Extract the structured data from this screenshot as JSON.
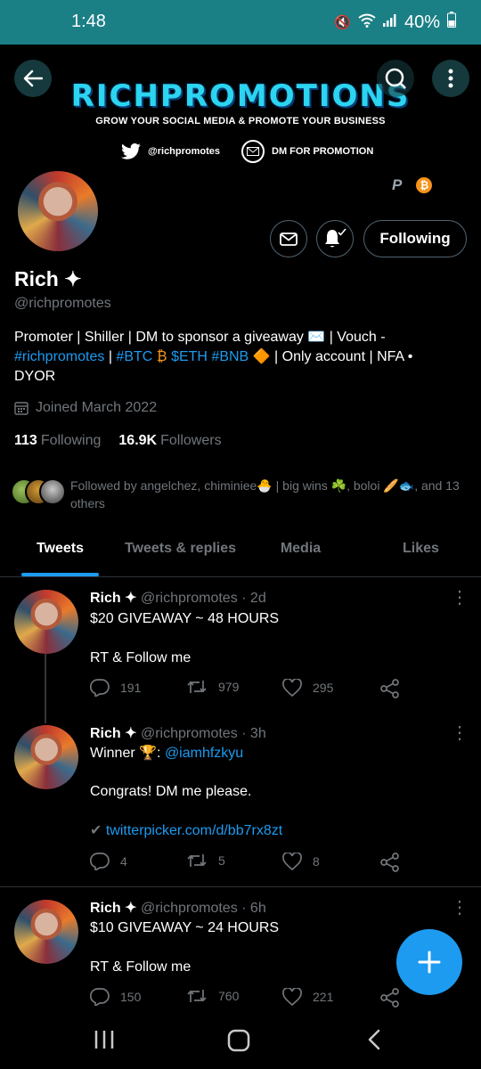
{
  "status_bar": {
    "time": "1:48",
    "battery": "40%"
  },
  "banner": {
    "title": "RICHPROMOTIONS",
    "tagline": "GROW YOUR SOCIAL MEDIA & PROMOTE YOUR BUSINESS",
    "twitter_handle": "@richpromotes",
    "dm_text": "DM FOR PROMOTION"
  },
  "profile": {
    "name": "Rich ✦",
    "handle": "@richpromotes",
    "bio_1": "Promoter | Shiller | DM to sponsor a giveaway ✉️ | Vouch -",
    "bio_tag1": "#richpromotes",
    "bio_sep1": " | ",
    "bio_tag2": "#BTC",
    "bio_emoji1": " ₿ ",
    "bio_tag3": "$ETH",
    "bio_sp": " ",
    "bio_tag4": "#BNB",
    "bio_rest": " 🔶 | Only account | NFA •",
    "bio_end": "DYOR",
    "joined": "Joined March 2022",
    "following_count": "113",
    "following_label": "Following",
    "followers_count": "16.9K",
    "followers_label": "Followers",
    "followed_by": "Followed by angelchez, chiminiee🐣 | big wins ☘️, boloi 🥖🐟, and 13 others",
    "follow_button": "Following"
  },
  "tabs": [
    "Tweets",
    "Tweets & replies",
    "Media",
    "Likes"
  ],
  "tweets": [
    {
      "name": "Rich ✦",
      "meta": "@richpromotes · 2d",
      "line1": "$20 GIVEAWAY ~ 48 HOURS",
      "line2": "RT & Follow me",
      "replies": "191",
      "retweets": "979",
      "likes": "295"
    },
    {
      "name": "Rich ✦",
      "meta": "@richpromotes · 3h",
      "winner_label": "Winner 🏆: ",
      "winner_handle": "@iamhfzkyu",
      "line2": "Congrats! DM me please.",
      "link": "twitterpicker.com/d/bb7rx8zt",
      "replies": "4",
      "retweets": "5",
      "likes": "8"
    },
    {
      "name": "Rich ✦",
      "meta": "@richpromotes · 6h",
      "line1": "$10 GIVEAWAY ~ 24 HOURS",
      "line2": "RT & Follow me",
      "replies": "150",
      "retweets": "760",
      "likes": "221"
    }
  ],
  "colors": {
    "accent": "#1d9bf0",
    "status_bar": "#1b7f86",
    "banner_title": "#2bd4ef"
  }
}
